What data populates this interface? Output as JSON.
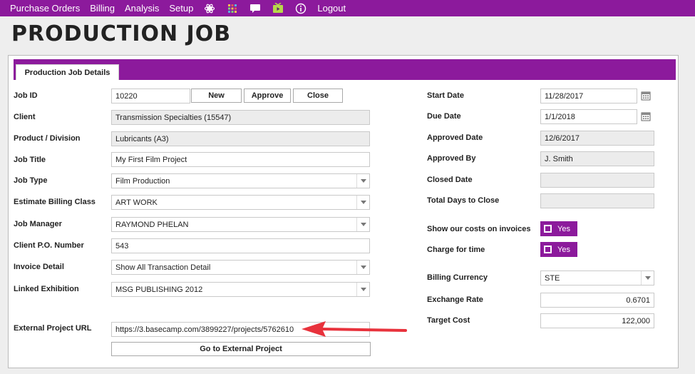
{
  "nav": {
    "items": [
      "Purchase Orders",
      "Billing",
      "Analysis",
      "Setup"
    ],
    "icons": [
      "molecule-icon",
      "grid-icon",
      "chat-icon",
      "media-icon",
      "info-icon"
    ],
    "logout": "Logout"
  },
  "page_title": "PRODUCTION JOB",
  "tab_label": "Production Job Details",
  "left": {
    "job_id": {
      "label": "Job ID",
      "value": "10220"
    },
    "buttons": {
      "new": "New",
      "approve": "Approve",
      "close": "Close"
    },
    "client": {
      "label": "Client",
      "value": "Transmission Specialties (15547)"
    },
    "product": {
      "label": "Product / Division",
      "value": "Lubricants (A3)"
    },
    "job_title": {
      "label": "Job Title",
      "value": "My First Film Project"
    },
    "job_type": {
      "label": "Job Type",
      "value": "Film Production"
    },
    "billing_class": {
      "label": "Estimate Billing Class",
      "value": "ART WORK"
    },
    "job_manager": {
      "label": "Job Manager",
      "value": "RAYMOND PHELAN"
    },
    "client_po": {
      "label": "Client P.O. Number",
      "value": "543"
    },
    "invoice_detail": {
      "label": "Invoice Detail",
      "value": "Show All Transaction Detail"
    },
    "linked_exhibition": {
      "label": "Linked Exhibition",
      "value": "MSG PUBLISHING 2012"
    },
    "external_url": {
      "label": "External Project URL",
      "value": "https://3.basecamp.com/3899227/projects/5762610"
    },
    "go_external": "Go to External Project"
  },
  "right": {
    "start_date": {
      "label": "Start Date",
      "value": "11/28/2017"
    },
    "due_date": {
      "label": "Due Date",
      "value": "1/1/2018"
    },
    "approved_date": {
      "label": "Approved Date",
      "value": "12/6/2017"
    },
    "approved_by": {
      "label": "Approved By",
      "value": "J. Smith"
    },
    "closed_date": {
      "label": "Closed Date",
      "value": ""
    },
    "total_days": {
      "label": "Total Days to Close",
      "value": ""
    },
    "show_costs": {
      "label": "Show our costs on invoices",
      "value": "Yes"
    },
    "charge_time": {
      "label": "Charge for time",
      "value": "Yes"
    },
    "currency": {
      "label": "Billing Currency",
      "value": "STE"
    },
    "exchange_rate": {
      "label": "Exchange Rate",
      "value": "0.6701"
    },
    "target_cost": {
      "label": "Target Cost",
      "value": "122,000"
    }
  },
  "colors": {
    "accent": "#8c1a9c",
    "annotation_arrow": "#e8323c"
  }
}
